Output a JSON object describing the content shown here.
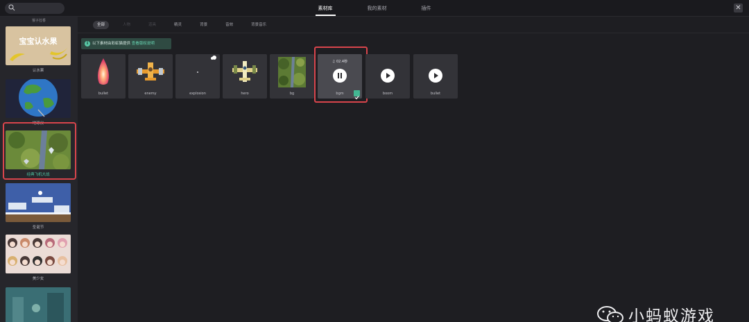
{
  "topbar": {
    "tabs": [
      {
        "label": "素材库",
        "active": true
      },
      {
        "label": "我的素材",
        "active": false
      },
      {
        "label": "插件",
        "active": false
      }
    ],
    "close_icon": "close-icon",
    "search_icon": "search-icon"
  },
  "sidebar": {
    "top_label": "猴子捡香",
    "items": [
      {
        "label": "认水果",
        "thumb_text": "宝宝认水果"
      },
      {
        "label": "地球仪"
      },
      {
        "label": "经典飞机大战",
        "selected": true
      },
      {
        "label": "圣诞节"
      },
      {
        "label": "美少女"
      },
      {
        "label": ""
      }
    ]
  },
  "categories": [
    {
      "label": "全部",
      "active": true
    },
    {
      "label": "人物",
      "dim": true
    },
    {
      "label": "道具",
      "dim": true
    },
    {
      "label": "精灵"
    },
    {
      "label": "背景"
    },
    {
      "label": "音效"
    },
    {
      "label": "背景音乐"
    }
  ],
  "notice": {
    "text": "以下素材由彩虹猫提供",
    "link": "查看版权说明"
  },
  "assets": [
    {
      "name": "bullet",
      "kind": "image"
    },
    {
      "name": "enemy",
      "kind": "image"
    },
    {
      "name": "explosion",
      "kind": "image"
    },
    {
      "name": "hero",
      "kind": "image"
    },
    {
      "name": "bg",
      "kind": "image"
    },
    {
      "name": "bgm",
      "kind": "audio",
      "duration": "02.4秒",
      "playing": true,
      "selected": true
    },
    {
      "name": "boom",
      "kind": "audio"
    },
    {
      "name": "bullet",
      "kind": "audio"
    }
  ],
  "watermark": {
    "text": "小蚂蚁游戏"
  },
  "colors": {
    "accent": "#4fc7a5",
    "highlight": "#d9454c",
    "notice_bg": "#2f4a42"
  }
}
